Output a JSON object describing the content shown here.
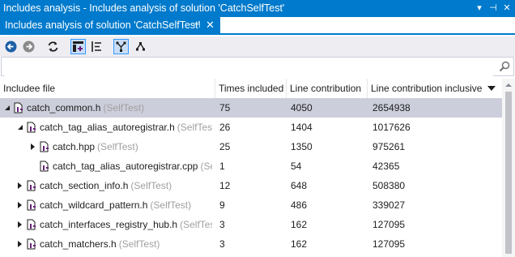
{
  "window": {
    "title": "Includes analysis - Includes analysis of solution 'CatchSelfTest'",
    "tab_label": "Includes analysis of solution 'CatchSelfTest'",
    "pin_glyph": "⊣",
    "close_glyph": "✕",
    "dropdown_glyph": "▾",
    "tb_pin_glyph": "⊣",
    "tb_close_glyph": "✕"
  },
  "search": {
    "value": "",
    "placeholder": ""
  },
  "columns": {
    "includee": "Includee file",
    "times": "Times included",
    "line": "Line contribution",
    "line_incl": "Line contribution inclusive"
  },
  "rows": [
    {
      "name": "catch_common.h",
      "project": "(SelfTest)",
      "times": "75",
      "line": "4050",
      "incl": "2654938",
      "level": 0,
      "state": "expanded",
      "selected": true
    },
    {
      "name": "catch_tag_alias_autoregistrar.h",
      "project": "(SelfTest)",
      "times": "26",
      "line": "1404",
      "incl": "1017626",
      "level": 1,
      "state": "expanded",
      "selected": false
    },
    {
      "name": "catch.hpp",
      "project": "(SelfTest)",
      "times": "25",
      "line": "1350",
      "incl": "975261",
      "level": 2,
      "state": "collapsed",
      "selected": false
    },
    {
      "name": "catch_tag_alias_autoregistrar.cpp",
      "project": "(SelfTest)",
      "times": "1",
      "line": "54",
      "incl": "42365",
      "level": 2,
      "state": "leaf",
      "selected": false
    },
    {
      "name": "catch_section_info.h",
      "project": "(SelfTest)",
      "times": "12",
      "line": "648",
      "incl": "508380",
      "level": 1,
      "state": "collapsed",
      "selected": false
    },
    {
      "name": "catch_wildcard_pattern.h",
      "project": "(SelfTest)",
      "times": "9",
      "line": "486",
      "incl": "339027",
      "level": 1,
      "state": "collapsed",
      "selected": false
    },
    {
      "name": "catch_interfaces_registry_hub.h",
      "project": "(SelfTest)",
      "times": "3",
      "line": "162",
      "incl": "127095",
      "level": 1,
      "state": "collapsed",
      "selected": false
    },
    {
      "name": "catch_matchers.h",
      "project": "(SelfTest)",
      "times": "3",
      "line": "162",
      "incl": "127095",
      "level": 1,
      "state": "collapsed",
      "selected": false
    }
  ],
  "colors": {
    "accent": "#007acc",
    "selected_row": "#cccedb",
    "file_icon": "#68217a"
  },
  "icons": [
    "back-icon",
    "forward-icon",
    "refresh-icon",
    "include-graph-icon",
    "list-icon",
    "hierarchy-icon",
    "tree-icon",
    "search-icon",
    "sort-desc-icon",
    "pin-icon",
    "close-icon",
    "dropdown-icon"
  ]
}
